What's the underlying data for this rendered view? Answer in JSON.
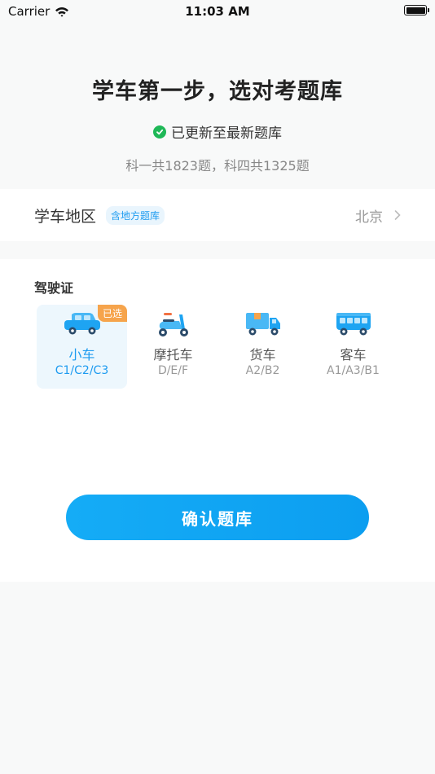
{
  "status_bar": {
    "carrier": "Carrier",
    "time": "11:03 AM"
  },
  "header": {
    "title": "学车第一步，选对考题库",
    "updated": "已更新至最新题库",
    "summary": "科一共1823题，科四共1325题"
  },
  "region": {
    "label": "学车地区",
    "badge": "含地方题库",
    "value": "北京"
  },
  "license": {
    "title": "驾驶证",
    "selected_tag": "已选",
    "vehicles": [
      {
        "name": "小车",
        "code": "C1/C2/C3",
        "icon": "car-icon",
        "selected": true
      },
      {
        "name": "摩托车",
        "code": "D/E/F",
        "icon": "motorcycle-icon",
        "selected": false
      },
      {
        "name": "货车",
        "code": "A2/B2",
        "icon": "truck-icon",
        "selected": false
      },
      {
        "name": "客车",
        "code": "A1/A3/B1",
        "icon": "bus-icon",
        "selected": false
      }
    ]
  },
  "confirm_label": "确认题库",
  "colors": {
    "accent": "#1d9bf0",
    "selected_tag": "#f6a44c",
    "check": "#1fb857"
  }
}
